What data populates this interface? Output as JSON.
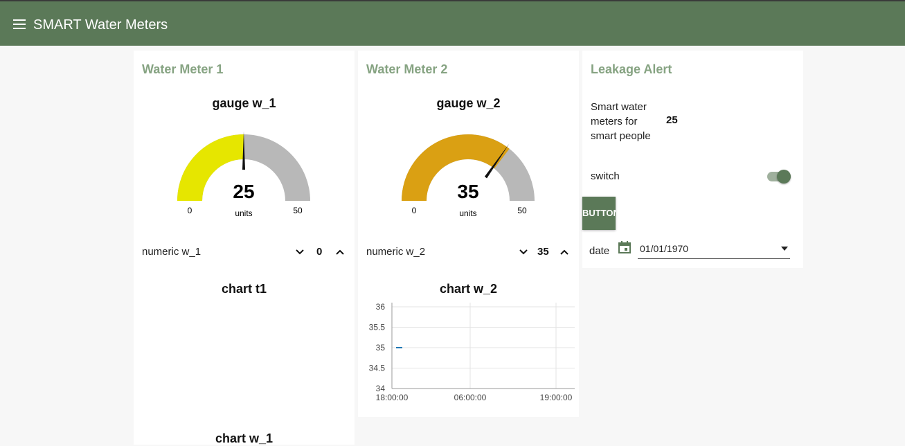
{
  "app": {
    "title": "SMART Water Meters"
  },
  "meter1": {
    "title": "Water Meter 1",
    "gauge": {
      "label": "gauge w_1",
      "value": 25,
      "min": 0,
      "max": 50,
      "units": "units",
      "min_label": "0",
      "max_label": "50",
      "color": "#e6e600"
    },
    "numeric": {
      "label": "numeric w_1",
      "value": "0"
    },
    "chart_t1_title": "chart t1",
    "chart_w1_title": "chart w_1"
  },
  "meter2": {
    "title": "Water Meter 2",
    "gauge": {
      "label": "gauge w_2",
      "value": 35,
      "min": 0,
      "max": 50,
      "units": "units",
      "min_label": "0",
      "max_label": "50",
      "color": "#daa013"
    },
    "numeric": {
      "label": "numeric w_2",
      "value": "35"
    },
    "chart_title": "chart w_2"
  },
  "leakage": {
    "title": "Leakage Alert",
    "text_lines": [
      "Smart water",
      "meters for",
      "smart people"
    ],
    "text_value": "25",
    "switch_label": "switch",
    "switch_on": true,
    "button_label": "BUTTON",
    "date_label": "date",
    "date_value": "01/01/1970"
  },
  "colors": {
    "header": "#5b7958",
    "card_title": "#86a382",
    "gauge_track": "#b8b8b8",
    "line": "#1f77b4"
  },
  "chart_data": {
    "type": "line",
    "title": "chart w_2",
    "xlabel": "",
    "ylabel": "",
    "x_ticks": [
      "18:00:00",
      "06:00:00",
      "19:00:00"
    ],
    "y_ticks": [
      "36",
      "35.5",
      "35",
      "34.5",
      "34"
    ],
    "ylim": [
      34,
      36
    ],
    "grid": true,
    "series": [
      {
        "values": [
          35,
          35
        ]
      }
    ]
  }
}
